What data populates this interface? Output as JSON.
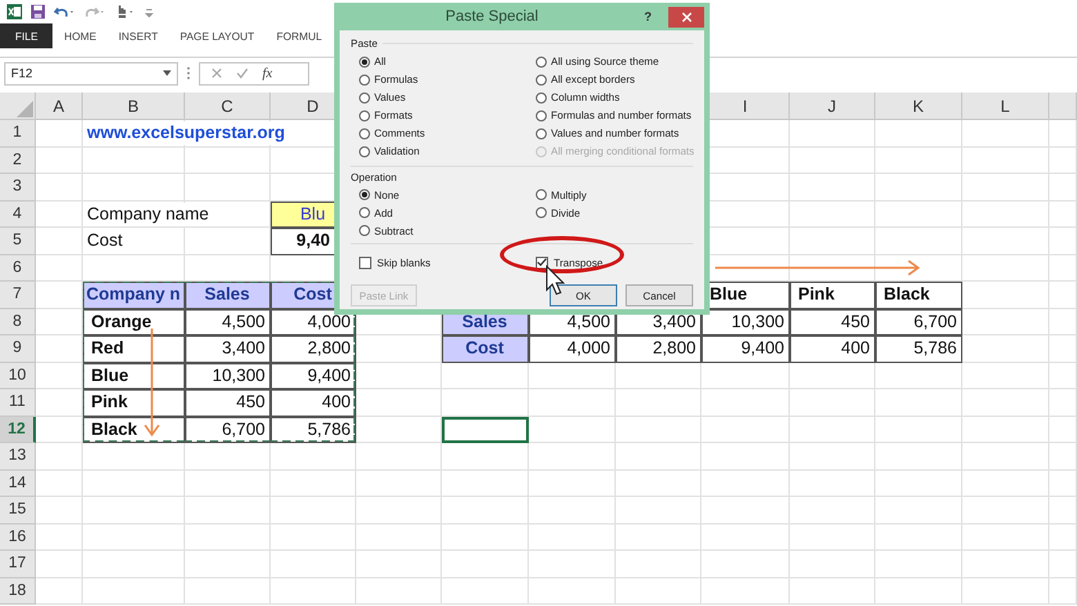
{
  "ribbon": {
    "tabs": [
      {
        "label": "FILE",
        "selected": true
      },
      {
        "label": "HOME",
        "selected": false
      },
      {
        "label": "INSERT",
        "selected": false
      },
      {
        "label": "PAGE LAYOUT",
        "selected": false
      },
      {
        "label": "FORMUL",
        "selected": false
      }
    ]
  },
  "formula_bar": {
    "name_box": "F12",
    "function_label": "fx"
  },
  "sheet": {
    "columns": [
      {
        "label": "A"
      },
      {
        "label": "B"
      },
      {
        "label": "C"
      },
      {
        "label": "D"
      },
      {},
      {},
      {},
      {},
      {
        "label": "I"
      },
      {
        "label": "J"
      },
      {
        "label": "K"
      },
      {
        "label": "L"
      }
    ],
    "rows": [
      {
        "number": "1",
        "selected": false,
        "cells": [
          {},
          {
            "kind": "link",
            "text": "www.excelsuperstar.org"
          }
        ]
      },
      {
        "number": "2",
        "selected": false,
        "cells": []
      },
      {
        "number": "3",
        "selected": false,
        "cells": []
      },
      {
        "number": "4",
        "selected": false,
        "cells": [
          {},
          {
            "kind": "text",
            "text": "Company name"
          },
          {},
          {
            "kind": "lookup",
            "text": "Blu"
          }
        ]
      },
      {
        "number": "5",
        "selected": false,
        "cells": [
          {},
          {
            "kind": "text",
            "text": "Cost"
          },
          {},
          {
            "kind": "result",
            "text": "9,40"
          }
        ]
      },
      {
        "number": "6",
        "selected": false,
        "cells": []
      },
      {
        "number": "7",
        "selected": false,
        "cells": [
          {},
          {
            "kind": "header",
            "text": "Company n",
            "copied": true
          },
          {
            "kind": "header",
            "text": "Sales",
            "copied": true
          },
          {
            "kind": "header",
            "text": "Cost",
            "copied": true
          },
          {},
          {},
          {},
          {},
          {
            "kind": "label",
            "text": "Blue"
          },
          {
            "kind": "label",
            "text": "Pink"
          },
          {
            "kind": "label",
            "text": "Black"
          }
        ]
      },
      {
        "number": "8",
        "selected": false,
        "cells": [
          {},
          {
            "kind": "label",
            "text": "Orange",
            "copied": true
          },
          {
            "kind": "number",
            "text": "4,500"
          },
          {
            "kind": "number",
            "text": "4,000",
            "copied": true
          },
          {},
          {
            "kind": "header",
            "text": "Sales"
          },
          {
            "kind": "number",
            "text": "4,500"
          },
          {
            "kind": "number",
            "text": "3,400"
          },
          {
            "kind": "number",
            "text": "10,300"
          },
          {
            "kind": "number",
            "text": "450"
          },
          {
            "kind": "number",
            "text": "6,700"
          }
        ]
      },
      {
        "number": "9",
        "selected": false,
        "cells": [
          {},
          {
            "kind": "label",
            "text": "Red",
            "copied": true
          },
          {
            "kind": "number",
            "text": "3,400"
          },
          {
            "kind": "number",
            "text": "2,800",
            "copied": true
          },
          {},
          {
            "kind": "header",
            "text": "Cost"
          },
          {
            "kind": "number",
            "text": "4,000"
          },
          {
            "kind": "number",
            "text": "2,800"
          },
          {
            "kind": "number",
            "text": "9,400"
          },
          {
            "kind": "number",
            "text": "400"
          },
          {
            "kind": "number",
            "text": "5,786"
          }
        ]
      },
      {
        "number": "10",
        "selected": false,
        "cells": [
          {},
          {
            "kind": "label",
            "text": "Blue",
            "copied": true
          },
          {
            "kind": "number",
            "text": "10,300"
          },
          {
            "kind": "number",
            "text": "9,400",
            "copied": true
          }
        ]
      },
      {
        "number": "11",
        "selected": false,
        "cells": [
          {},
          {
            "kind": "label",
            "text": "Pink",
            "copied": true
          },
          {
            "kind": "number",
            "text": "450"
          },
          {
            "kind": "number",
            "text": "400",
            "copied": true
          }
        ]
      },
      {
        "number": "12",
        "selected": true,
        "cells": [
          {},
          {
            "kind": "label",
            "text": "Black",
            "copied": true
          },
          {
            "kind": "number",
            "text": "6,700",
            "copied": true
          },
          {
            "kind": "number",
            "text": "5,786",
            "copied": true
          },
          {},
          {
            "selected": true
          }
        ]
      },
      {
        "number": "13",
        "selected": false,
        "cells": []
      },
      {
        "number": "14",
        "selected": false,
        "cells": []
      },
      {
        "number": "15",
        "selected": false,
        "cells": []
      },
      {
        "number": "16",
        "selected": false,
        "cells": []
      },
      {
        "number": "17",
        "selected": false,
        "cells": []
      },
      {
        "number": "18",
        "selected": false,
        "cells": []
      }
    ]
  },
  "dialog": {
    "title": "Paste Special",
    "help": "?",
    "paste": {
      "heading": "Paste",
      "options": [
        {
          "label": "All",
          "selected": true,
          "disabled": false
        },
        {
          "label": "Formulas",
          "selected": false,
          "disabled": false
        },
        {
          "label": "Values",
          "selected": false,
          "disabled": false
        },
        {
          "label": "Formats",
          "selected": false,
          "disabled": false
        },
        {
          "label": "Comments",
          "selected": false,
          "disabled": false
        },
        {
          "label": "Validation",
          "selected": false,
          "disabled": false
        },
        {
          "label": "All using Source theme",
          "selected": false,
          "disabled": false
        },
        {
          "label": "All except borders",
          "selected": false,
          "disabled": false
        },
        {
          "label": "Column widths",
          "selected": false,
          "disabled": false
        },
        {
          "label": "Formulas and number formats",
          "selected": false,
          "disabled": false
        },
        {
          "label": "Values and number formats",
          "selected": false,
          "disabled": false
        },
        {
          "label": "All merging conditional formats",
          "selected": false,
          "disabled": true
        }
      ]
    },
    "operation": {
      "heading": "Operation",
      "options": [
        {
          "label": "None",
          "selected": true
        },
        {
          "label": "Add",
          "selected": false
        },
        {
          "label": "Subtract",
          "selected": false
        },
        {
          "label": "Multiply",
          "selected": false
        },
        {
          "label": "Divide",
          "selected": false
        }
      ]
    },
    "checkboxes": [
      {
        "label": "Skip blanks",
        "checked": false
      },
      {
        "label": "Transpose",
        "checked": true
      }
    ],
    "buttons": [
      {
        "label": "Paste Link",
        "disabled": true,
        "default": false,
        "kind": "link"
      },
      {
        "label": "OK",
        "disabled": false,
        "default": true,
        "kind": "ok"
      },
      {
        "label": "Cancel",
        "disabled": false,
        "default": false,
        "kind": "cancel"
      }
    ]
  }
}
